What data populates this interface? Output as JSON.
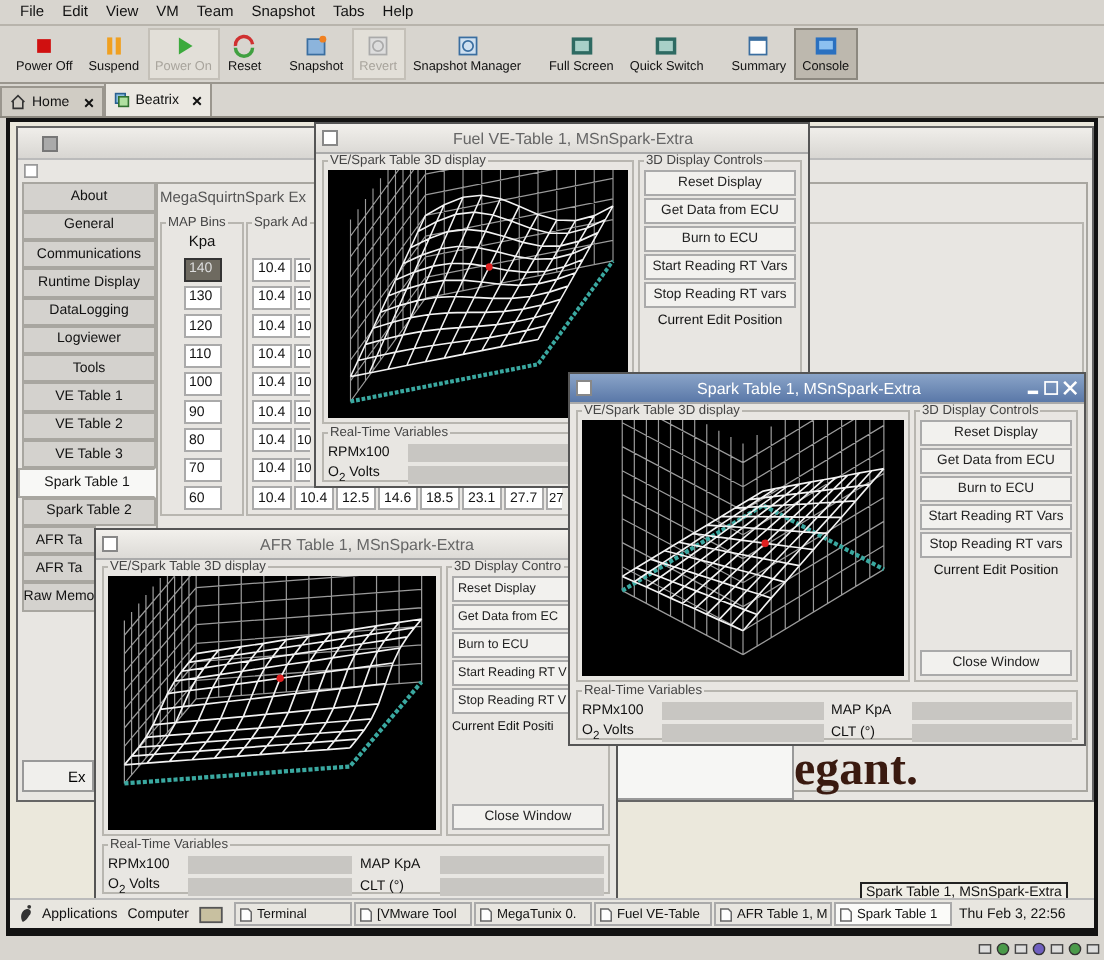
{
  "menu": [
    "File",
    "Edit",
    "View",
    "VM",
    "Team",
    "Snapshot",
    "Tabs",
    "Help"
  ],
  "toolbar": [
    {
      "kind": "stop",
      "label": "Power Off",
      "disabled": false,
      "selected": false
    },
    {
      "kind": "pause",
      "label": "Suspend",
      "disabled": false,
      "selected": false
    },
    {
      "kind": "play",
      "label": "Power On",
      "disabled": true,
      "selected": false
    },
    {
      "kind": "reset",
      "label": "Reset",
      "disabled": false,
      "selected": false
    },
    {
      "kind": "snapshot",
      "label": "Snapshot",
      "disabled": false,
      "selected": false
    },
    {
      "kind": "revert",
      "label": "Revert",
      "disabled": true,
      "selected": false
    },
    {
      "kind": "manager",
      "label": "Snapshot Manager",
      "disabled": false,
      "selected": false
    },
    {
      "kind": "fullscreen",
      "label": "Full Screen",
      "disabled": false,
      "selected": false
    },
    {
      "kind": "switch",
      "label": "Quick Switch",
      "disabled": false,
      "selected": false
    },
    {
      "kind": "summary",
      "label": "Summary",
      "disabled": false,
      "selected": false
    },
    {
      "kind": "console",
      "label": "Console",
      "disabled": false,
      "selected": true
    }
  ],
  "tabs": [
    {
      "kind": "home",
      "label": "Home",
      "selected": false
    },
    {
      "kind": "vm",
      "label": "Beatrix",
      "selected": true
    }
  ],
  "main_window": {
    "notebook_tabs": [
      {
        "label": "About",
        "selected": false
      },
      {
        "label": "General",
        "selected": false
      },
      {
        "label": "Communications",
        "selected": false
      },
      {
        "label": "Runtime Display",
        "selected": false
      },
      {
        "label": "DataLogging",
        "selected": false
      },
      {
        "label": "Logviewer",
        "selected": false
      },
      {
        "label": "Tools",
        "selected": false
      },
      {
        "label": "VE Table 1",
        "selected": false
      },
      {
        "label": "VE Table 2",
        "selected": false
      },
      {
        "label": "VE Table 3",
        "selected": false
      },
      {
        "label": "Spark Table 1",
        "selected": true
      },
      {
        "label": "Spark Table 2",
        "selected": false
      },
      {
        "label": "AFR Ta",
        "selected": false
      },
      {
        "label": "AFR Ta",
        "selected": false
      },
      {
        "label": "Raw Memo",
        "selected": false
      }
    ],
    "exit_button": "Ex",
    "page_title": "MegaSquirtnSpark Ex",
    "bins_title": "MAP Bins",
    "bins_unit": "Kpa",
    "bins": [
      {
        "value": "140",
        "selected": true
      },
      {
        "value": "130",
        "selected": false
      },
      {
        "value": "120",
        "selected": false
      },
      {
        "value": "110",
        "selected": false
      },
      {
        "value": "100",
        "selected": false
      },
      {
        "value": "90",
        "selected": false
      },
      {
        "value": "80",
        "selected": false
      },
      {
        "value": "70",
        "selected": false
      },
      {
        "value": "60",
        "selected": false
      }
    ],
    "table_title": "Spark Ad",
    "rows": [
      [
        "10.4",
        "10"
      ],
      [
        "10.4",
        "10"
      ],
      [
        "10.4",
        "10"
      ],
      [
        "10.4",
        "10"
      ],
      [
        "10.4",
        "10"
      ],
      [
        "10.4",
        "10"
      ],
      [
        "10.4",
        "10"
      ],
      [
        "10.4",
        "10"
      ],
      [
        "10.4",
        "10.4",
        "12.5",
        "14.6",
        "18.5",
        "23.1",
        "27.7",
        "27"
      ]
    ]
  },
  "backdrop_text": "egant.",
  "windows": [
    {
      "title": "Fuel VE-Table 1, MSnSpark-Extra",
      "active": false,
      "display_title": "VE/Spark Table 3D display",
      "controls_title": "3D Display Controls",
      "buttons": [
        "Reset Display",
        "Get Data from ECU",
        "Burn to ECU",
        "Start Reading RT Vars",
        "Stop Reading RT vars"
      ],
      "position_label": "Current Edit Position",
      "rt_title": "Real-Time Variables",
      "rt_labels": [
        [
          "RPMx100",
          "O$_{2}$ Volts"
        ]
      ]
    },
    {
      "title": "AFR Table 1, MSnSpark-Extra",
      "active": false,
      "display_title": "VE/Spark Table 3D display",
      "controls_title": "3D Display Contro",
      "buttons": [
        "Reset Display",
        "Get Data from EC",
        "Burn to ECU",
        "Start Reading RT V",
        "Stop Reading RT V"
      ],
      "position_label": "Current Edit Positi",
      "close_button": "Close Window",
      "rt_title": "Real-Time Variables",
      "rt_labels": [
        [
          "RPMx100",
          "O$_{2}$ Volts"
        ],
        [
          "MAP KpA",
          "CLT (°)"
        ]
      ]
    },
    {
      "title": "Spark Table 1, MSnSpark-Extra",
      "active": true,
      "display_title": "VE/Spark Table 3D display",
      "controls_title": "3D Display Controls",
      "buttons": [
        "Reset Display",
        "Get Data from ECU",
        "Burn to ECU",
        "Start Reading RT Vars",
        "Stop Reading RT vars"
      ],
      "position_label": "Current Edit Position",
      "close_button": "Close Window",
      "rt_title": "Real-Time Variables",
      "rt_labels": [
        [
          "RPMx100",
          "O$_{2}$ Volts"
        ],
        [
          "MAP KpA",
          "CLT (°)"
        ]
      ]
    }
  ],
  "tooltip": "Spark Table 1, MSnSpark-Extra",
  "taskbar": {
    "menus": [
      "Applications",
      "Computer"
    ],
    "items": [
      {
        "label": "Terminal",
        "selected": false
      },
      {
        "label": "[VMware Tool",
        "selected": false
      },
      {
        "label": "MegaTunix 0.",
        "selected": false
      },
      {
        "label": "Fuel VE-Table",
        "selected": false
      },
      {
        "label": "AFR Table 1, M",
        "selected": false
      },
      {
        "label": "Spark Table 1",
        "selected": true
      }
    ],
    "clock": "Thu Feb 3, 22:56"
  }
}
